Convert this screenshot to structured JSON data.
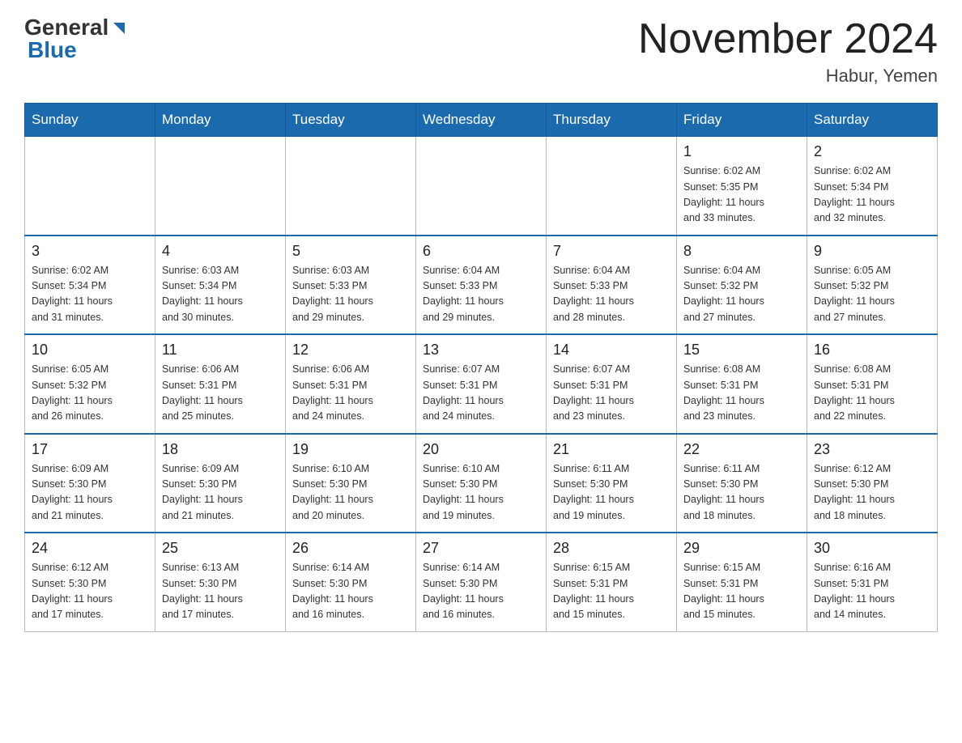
{
  "header": {
    "logo_general": "General",
    "logo_blue": "Blue",
    "title": "November 2024",
    "location": "Habur, Yemen"
  },
  "weekdays": [
    "Sunday",
    "Monday",
    "Tuesday",
    "Wednesday",
    "Thursday",
    "Friday",
    "Saturday"
  ],
  "weeks": [
    [
      {
        "day": "",
        "info": ""
      },
      {
        "day": "",
        "info": ""
      },
      {
        "day": "",
        "info": ""
      },
      {
        "day": "",
        "info": ""
      },
      {
        "day": "",
        "info": ""
      },
      {
        "day": "1",
        "info": "Sunrise: 6:02 AM\nSunset: 5:35 PM\nDaylight: 11 hours\nand 33 minutes."
      },
      {
        "day": "2",
        "info": "Sunrise: 6:02 AM\nSunset: 5:34 PM\nDaylight: 11 hours\nand 32 minutes."
      }
    ],
    [
      {
        "day": "3",
        "info": "Sunrise: 6:02 AM\nSunset: 5:34 PM\nDaylight: 11 hours\nand 31 minutes."
      },
      {
        "day": "4",
        "info": "Sunrise: 6:03 AM\nSunset: 5:34 PM\nDaylight: 11 hours\nand 30 minutes."
      },
      {
        "day": "5",
        "info": "Sunrise: 6:03 AM\nSunset: 5:33 PM\nDaylight: 11 hours\nand 29 minutes."
      },
      {
        "day": "6",
        "info": "Sunrise: 6:04 AM\nSunset: 5:33 PM\nDaylight: 11 hours\nand 29 minutes."
      },
      {
        "day": "7",
        "info": "Sunrise: 6:04 AM\nSunset: 5:33 PM\nDaylight: 11 hours\nand 28 minutes."
      },
      {
        "day": "8",
        "info": "Sunrise: 6:04 AM\nSunset: 5:32 PM\nDaylight: 11 hours\nand 27 minutes."
      },
      {
        "day": "9",
        "info": "Sunrise: 6:05 AM\nSunset: 5:32 PM\nDaylight: 11 hours\nand 27 minutes."
      }
    ],
    [
      {
        "day": "10",
        "info": "Sunrise: 6:05 AM\nSunset: 5:32 PM\nDaylight: 11 hours\nand 26 minutes."
      },
      {
        "day": "11",
        "info": "Sunrise: 6:06 AM\nSunset: 5:31 PM\nDaylight: 11 hours\nand 25 minutes."
      },
      {
        "day": "12",
        "info": "Sunrise: 6:06 AM\nSunset: 5:31 PM\nDaylight: 11 hours\nand 24 minutes."
      },
      {
        "day": "13",
        "info": "Sunrise: 6:07 AM\nSunset: 5:31 PM\nDaylight: 11 hours\nand 24 minutes."
      },
      {
        "day": "14",
        "info": "Sunrise: 6:07 AM\nSunset: 5:31 PM\nDaylight: 11 hours\nand 23 minutes."
      },
      {
        "day": "15",
        "info": "Sunrise: 6:08 AM\nSunset: 5:31 PM\nDaylight: 11 hours\nand 23 minutes."
      },
      {
        "day": "16",
        "info": "Sunrise: 6:08 AM\nSunset: 5:31 PM\nDaylight: 11 hours\nand 22 minutes."
      }
    ],
    [
      {
        "day": "17",
        "info": "Sunrise: 6:09 AM\nSunset: 5:30 PM\nDaylight: 11 hours\nand 21 minutes."
      },
      {
        "day": "18",
        "info": "Sunrise: 6:09 AM\nSunset: 5:30 PM\nDaylight: 11 hours\nand 21 minutes."
      },
      {
        "day": "19",
        "info": "Sunrise: 6:10 AM\nSunset: 5:30 PM\nDaylight: 11 hours\nand 20 minutes."
      },
      {
        "day": "20",
        "info": "Sunrise: 6:10 AM\nSunset: 5:30 PM\nDaylight: 11 hours\nand 19 minutes."
      },
      {
        "day": "21",
        "info": "Sunrise: 6:11 AM\nSunset: 5:30 PM\nDaylight: 11 hours\nand 19 minutes."
      },
      {
        "day": "22",
        "info": "Sunrise: 6:11 AM\nSunset: 5:30 PM\nDaylight: 11 hours\nand 18 minutes."
      },
      {
        "day": "23",
        "info": "Sunrise: 6:12 AM\nSunset: 5:30 PM\nDaylight: 11 hours\nand 18 minutes."
      }
    ],
    [
      {
        "day": "24",
        "info": "Sunrise: 6:12 AM\nSunset: 5:30 PM\nDaylight: 11 hours\nand 17 minutes."
      },
      {
        "day": "25",
        "info": "Sunrise: 6:13 AM\nSunset: 5:30 PM\nDaylight: 11 hours\nand 17 minutes."
      },
      {
        "day": "26",
        "info": "Sunrise: 6:14 AM\nSunset: 5:30 PM\nDaylight: 11 hours\nand 16 minutes."
      },
      {
        "day": "27",
        "info": "Sunrise: 6:14 AM\nSunset: 5:30 PM\nDaylight: 11 hours\nand 16 minutes."
      },
      {
        "day": "28",
        "info": "Sunrise: 6:15 AM\nSunset: 5:31 PM\nDaylight: 11 hours\nand 15 minutes."
      },
      {
        "day": "29",
        "info": "Sunrise: 6:15 AM\nSunset: 5:31 PM\nDaylight: 11 hours\nand 15 minutes."
      },
      {
        "day": "30",
        "info": "Sunrise: 6:16 AM\nSunset: 5:31 PM\nDaylight: 11 hours\nand 14 minutes."
      }
    ]
  ]
}
